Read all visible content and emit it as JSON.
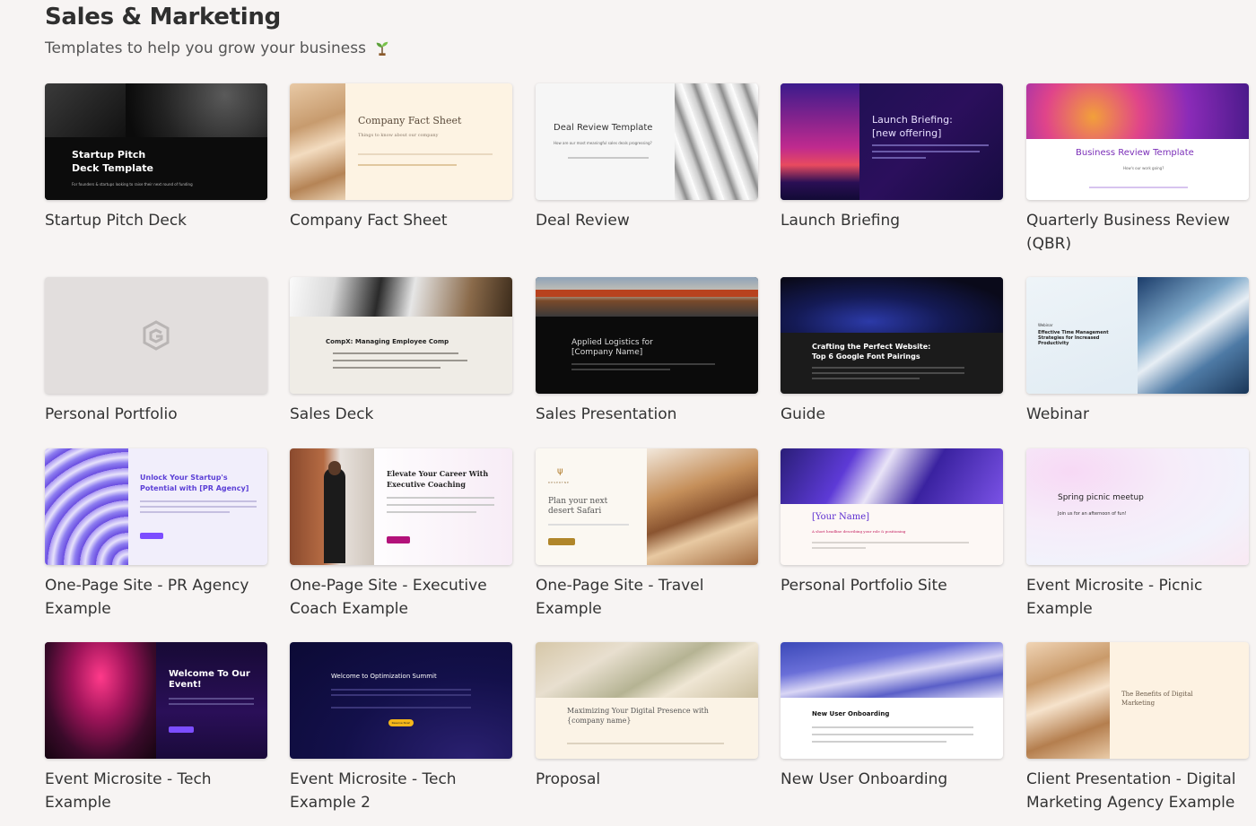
{
  "page": {
    "title": "Sales & Marketing",
    "subtitle": "Templates to help you grow your business"
  },
  "templates": [
    {
      "name": "Startup Pitch Deck",
      "thumb": {
        "title": "Startup Pitch\nDeck Template",
        "sub": "For founders & startups looking to raise their next round of funding"
      }
    },
    {
      "name": "Company Fact Sheet",
      "thumb": {
        "title": "Company Fact Sheet",
        "sub": "Things to know about our company"
      }
    },
    {
      "name": "Deal Review",
      "thumb": {
        "title": "Deal Review Template",
        "sub": "How are our most meaningful sales deals progressing?"
      }
    },
    {
      "name": "Launch Briefing",
      "thumb": {
        "title": "Launch Briefing:\n[new offering]"
      }
    },
    {
      "name": "Quarterly Business Review (QBR)",
      "thumb": {
        "title": "Business Review Template",
        "sub": "How's our work going?"
      }
    },
    {
      "name": "Personal Portfolio",
      "thumb": {}
    },
    {
      "name": "Sales Deck",
      "thumb": {
        "title": "CompX: Managing Employee Comp"
      }
    },
    {
      "name": "Sales Presentation",
      "thumb": {
        "title": "Applied Logistics for\n[Company Name]"
      }
    },
    {
      "name": "Guide",
      "thumb": {
        "title": "Crafting the Perfect Website:\nTop 6 Google Font Pairings"
      }
    },
    {
      "name": "Webinar",
      "thumb": {
        "title": "Effective Time Management Strategies for Increased Productivity",
        "kicker": "Webinar"
      }
    },
    {
      "name": "One-Page Site - PR Agency Example",
      "thumb": {
        "title": "Unlock Your Startup's\nPotential with [PR Agency]"
      }
    },
    {
      "name": "One-Page Site - Executive Coach Example",
      "thumb": {
        "title": "Elevate Your Career With\nExecutive Coaching"
      }
    },
    {
      "name": "One-Page Site - Travel Example",
      "thumb": {
        "title": "Plan your next\ndesert Safari",
        "kicker": "DESERTNE"
      }
    },
    {
      "name": "Personal Portfolio Site",
      "thumb": {
        "title": "[Your Name]",
        "sub": "A short headline describing your role & positioning"
      }
    },
    {
      "name": "Event Microsite - Picnic Example",
      "thumb": {
        "title": "Spring picnic meetup",
        "sub": "Join us for an afternoon of fun!"
      }
    },
    {
      "name": "Event Microsite - Tech Example",
      "thumb": {
        "title": "Welcome To Our\nEvent!"
      }
    },
    {
      "name": "Event Microsite - Tech Example 2",
      "thumb": {
        "title": "Welcome to Optimization Summit",
        "btn": "Reserve Now!"
      }
    },
    {
      "name": "Proposal",
      "thumb": {
        "title": "Maximizing Your Digital Presence with\n{company name}"
      }
    },
    {
      "name": "New User Onboarding",
      "thumb": {
        "title": "New User Onboarding"
      }
    },
    {
      "name": "Client Presentation - Digital Marketing Agency Example",
      "thumb": {
        "title": "The Benefits of Digital\nMarketing"
      }
    }
  ],
  "colors": {
    "background": "#f7f4f3",
    "text": "#333333",
    "accent_purple": "#7c4dff",
    "accent_magenta": "#c2185b"
  }
}
